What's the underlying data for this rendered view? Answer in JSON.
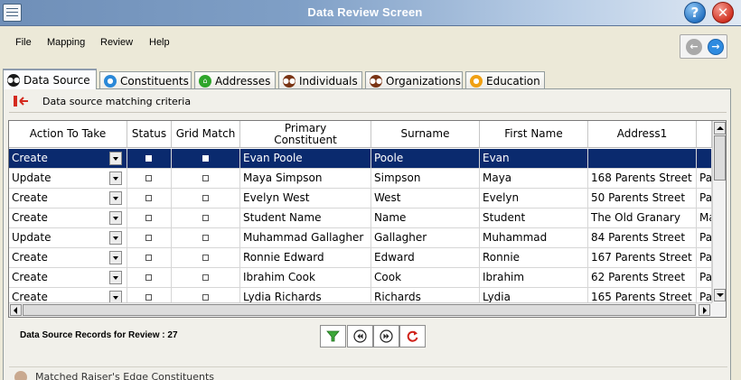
{
  "window": {
    "title": "Data Review Screen",
    "help_icon": "help-icon",
    "close_icon": "close-icon"
  },
  "menu": [
    "File",
    "Mapping",
    "Review",
    "Help"
  ],
  "nav": {
    "back_icon": "arrow-left-icon",
    "forward_icon": "arrow-right-icon"
  },
  "tabs": [
    {
      "label": "Data Source",
      "icon": "people-icon",
      "color": "#1a1a1a"
    },
    {
      "label": "Constituents",
      "icon": "person-icon",
      "color": "#2a88d8"
    },
    {
      "label": "Addresses",
      "icon": "home-icon",
      "color": "#2ea52a"
    },
    {
      "label": "Individuals",
      "icon": "people-icon",
      "color": "#7a3414"
    },
    {
      "label": "Organizations",
      "icon": "people-icon",
      "color": "#7a3414"
    },
    {
      "label": "Education",
      "icon": "education-icon",
      "color": "#f0a012"
    }
  ],
  "criteria": {
    "label": "Data source matching criteria"
  },
  "grid": {
    "columns": [
      "Action To Take",
      "Status",
      "Grid Match",
      "Primary Constituent",
      "Surname",
      "First Name",
      "Address1",
      ""
    ],
    "rows": [
      {
        "action": "Create",
        "primary": "Evan Poole",
        "surname": "Poole",
        "first": "Evan",
        "address": "",
        "extra": "",
        "selected": true
      },
      {
        "action": "Update",
        "primary": "Maya Simpson",
        "surname": "Simpson",
        "first": "Maya",
        "address": "168 Parents Street",
        "extra": "Pa"
      },
      {
        "action": "Create",
        "primary": "Evelyn West",
        "surname": "West",
        "first": "Evelyn",
        "address": "50 Parents Street",
        "extra": "Pa"
      },
      {
        "action": "Create",
        "primary": "Student Name",
        "surname": "Name",
        "first": "Student",
        "address": "The Old Granary",
        "extra": "Ma"
      },
      {
        "action": "Update",
        "primary": "Muhammad Gallagher",
        "surname": "Gallagher",
        "first": "Muhammad",
        "address": "84 Parents Street",
        "extra": "Pa"
      },
      {
        "action": "Create",
        "primary": "Ronnie Edward",
        "surname": "Edward",
        "first": "Ronnie",
        "address": "167 Parents Street",
        "extra": "Pa"
      },
      {
        "action": "Create",
        "primary": "Ibrahim Cook",
        "surname": "Cook",
        "first": "Ibrahim",
        "address": "62 Parents Street",
        "extra": "Pa"
      },
      {
        "action": "Create",
        "primary": "Lydia Richards",
        "surname": "Richards",
        "first": "Lydia",
        "address": "165 Parents Street",
        "extra": "Pa"
      }
    ]
  },
  "footer": {
    "records_label": "Data Source Records for Review : 27",
    "buttons": [
      "filter-icon",
      "previous-icon",
      "next-icon",
      "refresh-icon"
    ]
  },
  "matched": {
    "label": "Matched Raiser's Edge Constituents"
  }
}
